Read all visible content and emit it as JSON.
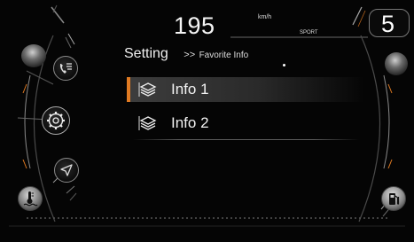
{
  "header": {
    "speed": "195",
    "speed_unit": "km/h",
    "drive_mode": "SPORT",
    "gear": "5"
  },
  "breadcrumb": {
    "current": "Setting",
    "separator": ">>",
    "sub": "Favorite Info"
  },
  "menu": {
    "items": [
      {
        "label": "Info 1",
        "selected": true,
        "icon": "layers-icon"
      },
      {
        "label": "Info 2",
        "selected": false,
        "icon": "layers-icon"
      }
    ]
  },
  "side_buttons": {
    "left": [
      "phone-list-icon",
      "gear-icon",
      "navigation-icon"
    ],
    "corner_left": "temperature-icon",
    "corner_right": "fuel-pump-icon"
  },
  "colors": {
    "accent": "#e07a22",
    "background": "#050505"
  }
}
